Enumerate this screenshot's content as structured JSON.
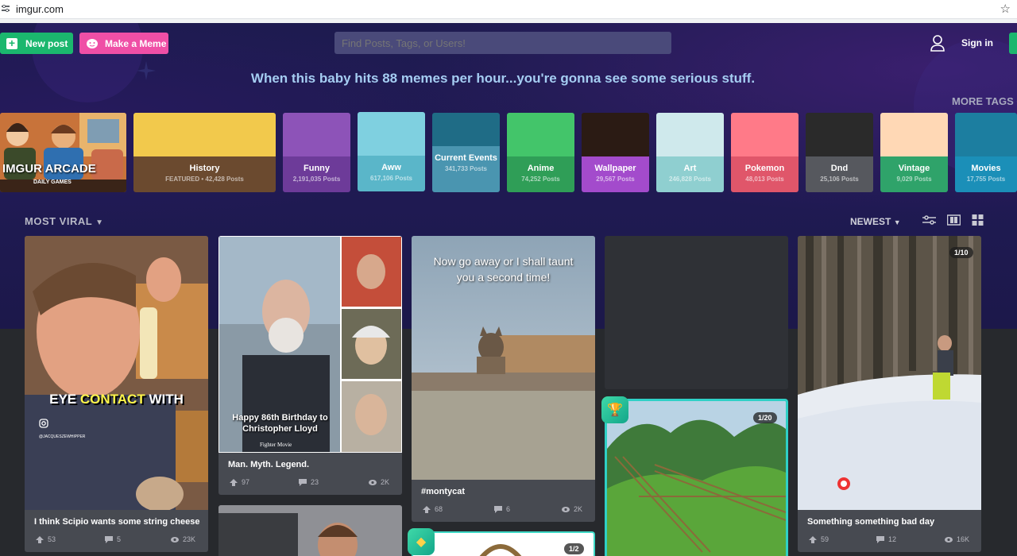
{
  "browser": {
    "url": "imgur.com"
  },
  "header": {
    "new_post_label": "New post",
    "make_meme_label": "Make a Meme",
    "search_placeholder": "Find Posts, Tags, or Users!",
    "sign_in_label": "Sign in"
  },
  "hero": {
    "tagline": "When this baby hits 88 memes per hour...you're gonna see some serious stuff.",
    "more_tags_label": "MORE TAGS"
  },
  "arcade": {
    "title": "IMGUR ARCADE",
    "subtitle": "DAILY GAMES"
  },
  "tags": [
    {
      "name": "History",
      "posts": "FEATURED • 42,428 Posts",
      "art": "#f2c94c",
      "foot": "#6b4a2f"
    },
    {
      "name": "Funny",
      "posts": "2,191,035 Posts",
      "art": "#8d53b8",
      "foot": "#6d3b99"
    },
    {
      "name": "Aww",
      "posts": "617,106 Posts",
      "art": "#7fd0e0",
      "foot": "#5ab6c9"
    },
    {
      "name": "Current Events",
      "posts": "341,733 Posts",
      "art": "#1f6c86",
      "foot": "#4a95b0"
    },
    {
      "name": "Anime",
      "posts": "74,252 Posts",
      "art": "#43c56a",
      "foot": "#2f9e57"
    },
    {
      "name": "Wallpaper",
      "posts": "29,567 Posts",
      "art": "#2b1b14",
      "foot": "#a34bcc"
    },
    {
      "name": "Art",
      "posts": "246,828 Posts",
      "art": "#cfe9ec",
      "foot": "#8fcfd0"
    },
    {
      "name": "Pokemon",
      "posts": "48,013 Posts",
      "art": "#ff7a88",
      "foot": "#e0566a"
    },
    {
      "name": "Dnd",
      "posts": "25,106 Posts",
      "art": "#2a2a2a",
      "foot": "#56585e"
    },
    {
      "name": "Vintage",
      "posts": "9,029 Posts",
      "art": "#ffd8b5",
      "foot": "#2fa36a"
    },
    {
      "name": "Movies",
      "posts": "17,755 Posts",
      "art": "#1c7ea0",
      "foot": "#1b8fb8"
    }
  ],
  "sort": {
    "left_label": "MOST VIRAL",
    "right_label": "NEWEST"
  },
  "posts": [
    {
      "title": "I think Scipio wants some string cheese",
      "up": "53",
      "comments": "5",
      "views": "23K",
      "overlay": "EYE CONTACT WITH",
      "overlay_highlight": "CONTACT",
      "handle": "@JACQUESZEWHIPPER"
    },
    {
      "title": "Man. Myth. Legend.",
      "up": "97",
      "comments": "23",
      "views": "2K",
      "overlay": "Happy 86th Birthday to Christopher Lloyd",
      "caption": "Fighter Movie"
    },
    {
      "title": "#montycat",
      "up": "68",
      "comments": "6",
      "views": "2K",
      "overlay": "Now go away or I shall taunt you a second time!"
    },
    {
      "title": "",
      "count": "1/20"
    },
    {
      "title": "Something something bad day",
      "up": "59",
      "comments": "12",
      "views": "16K",
      "count": "1/10"
    },
    {
      "title": "",
      "count": "1/2"
    }
  ],
  "colors": {
    "green": "#1bb76e",
    "pink": "#ef4fa6",
    "bg": "#27292d",
    "card": "#474a51"
  }
}
